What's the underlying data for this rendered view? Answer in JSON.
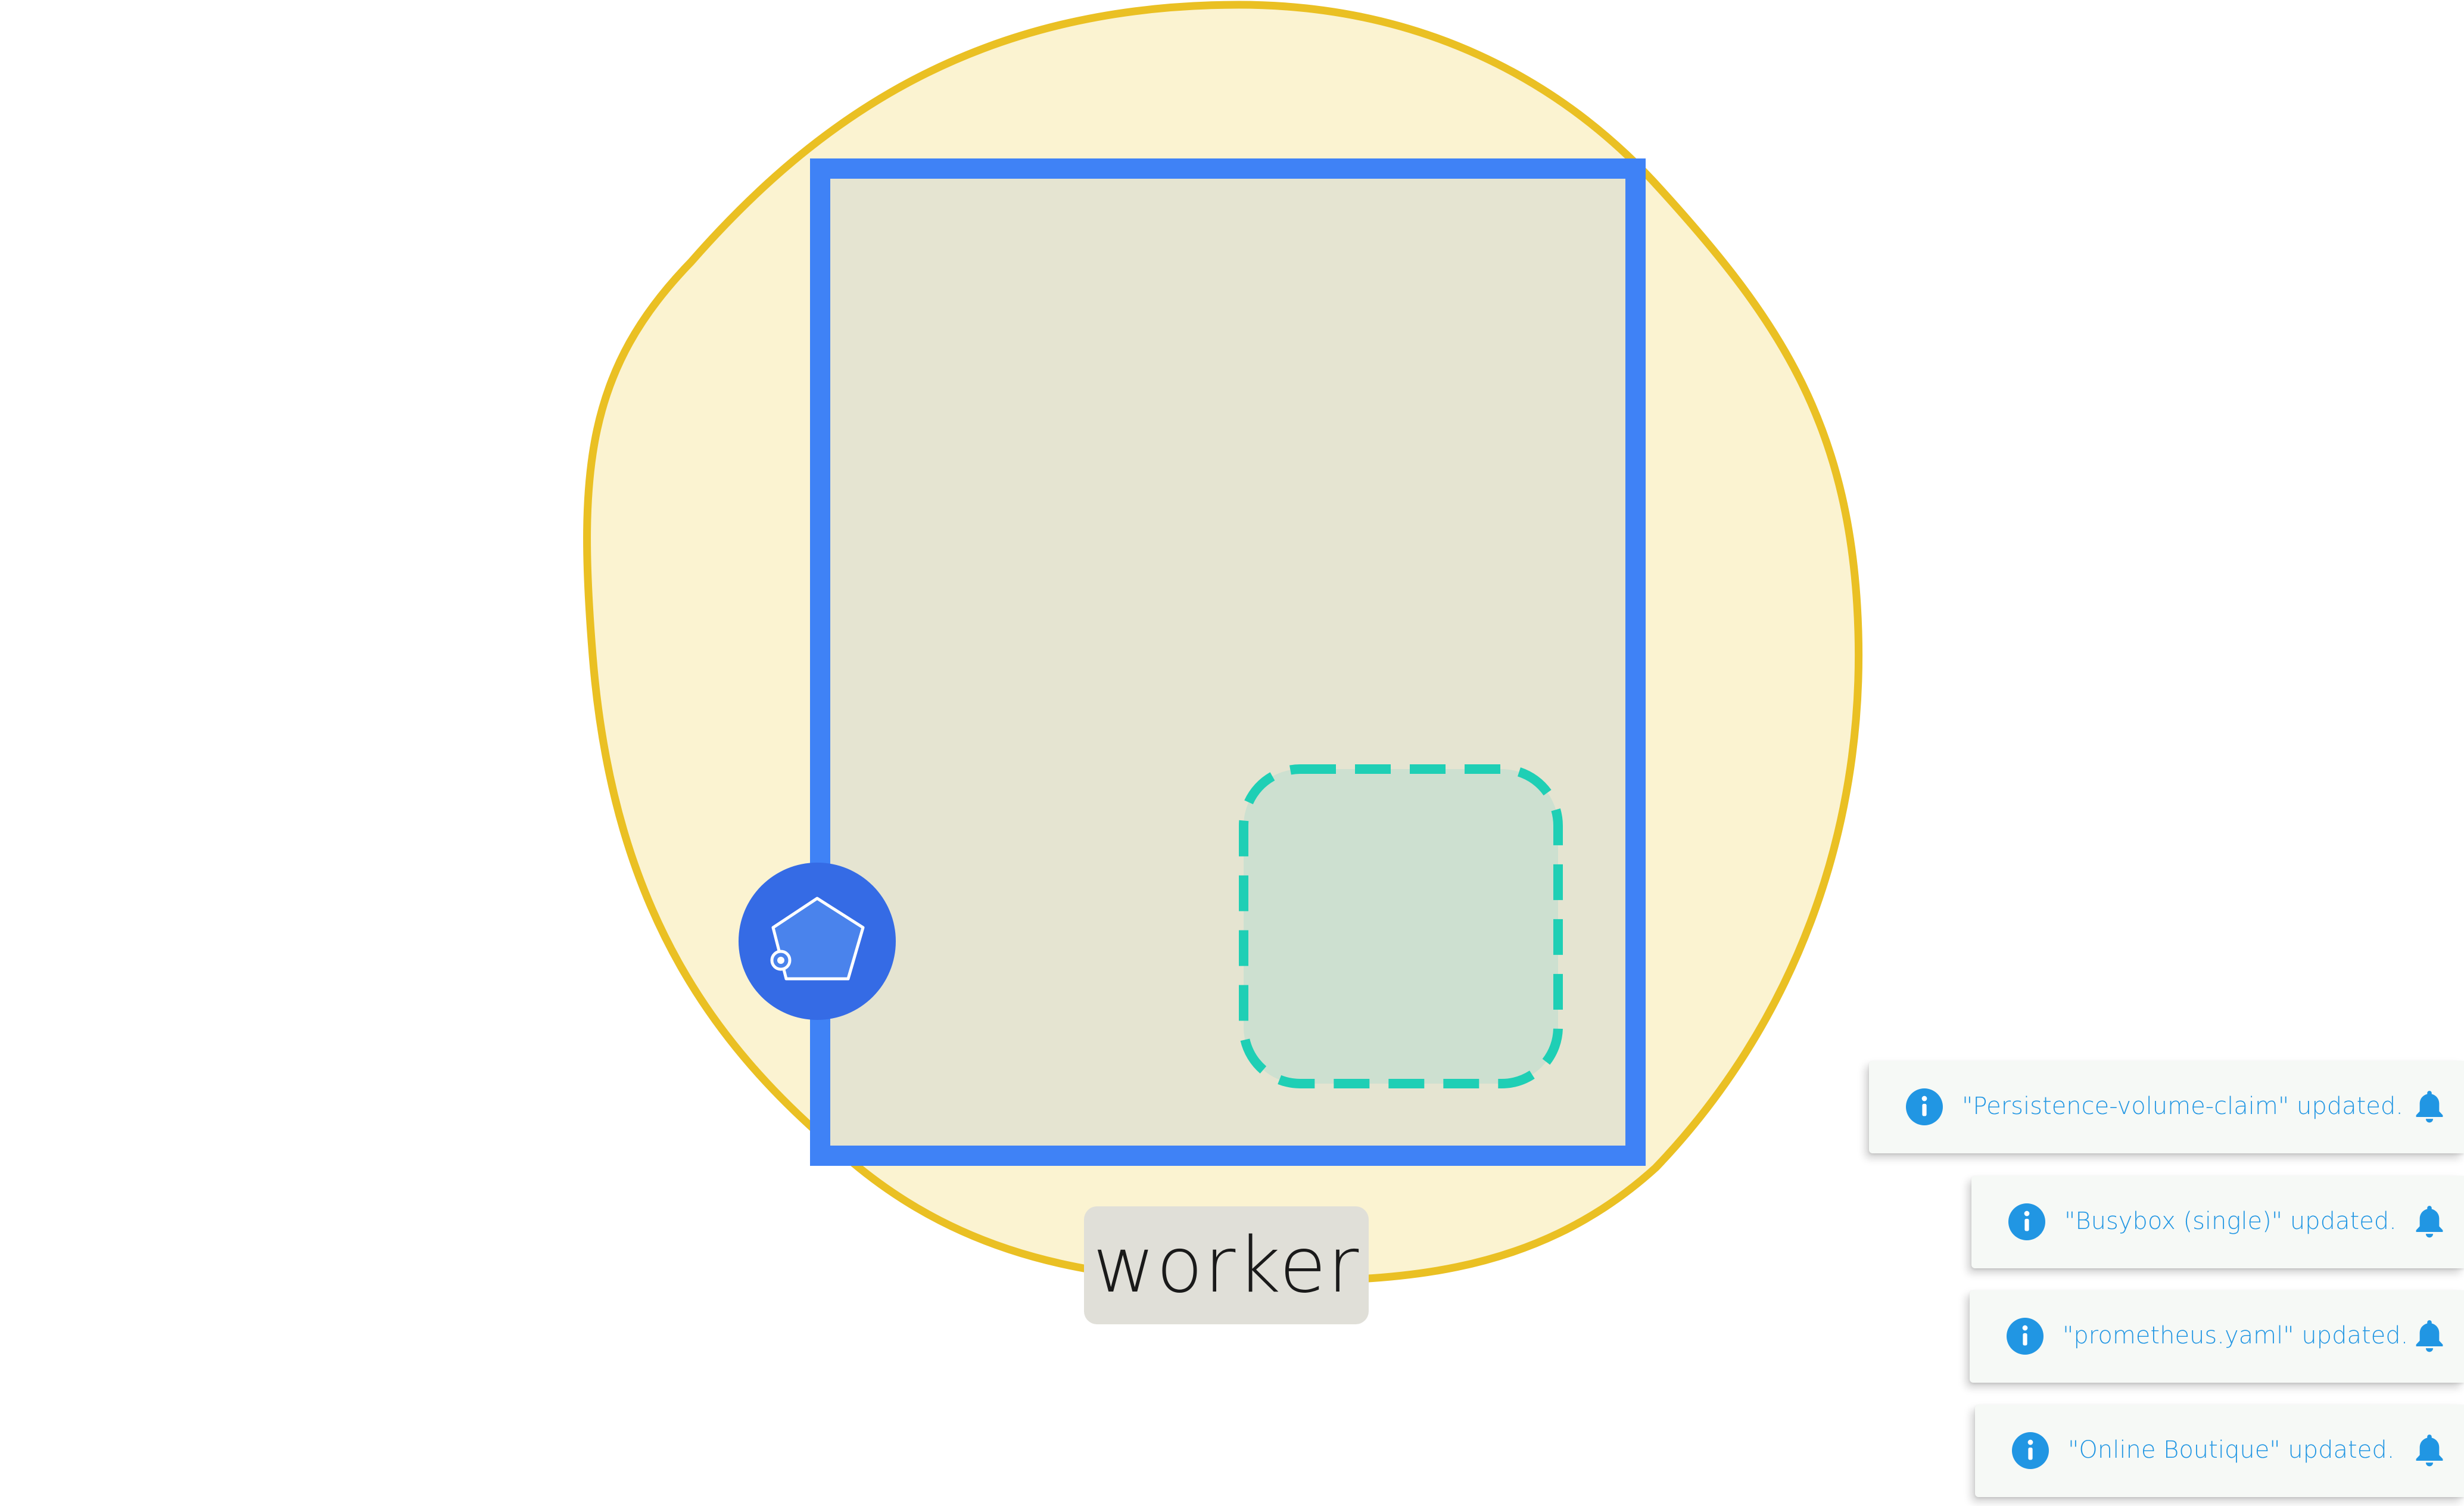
{
  "diagram": {
    "node_label": "worker",
    "colors": {
      "blob_fill": "#fbf3d1",
      "blob_stroke": "#eac023",
      "node_fill": "#e5e4d1",
      "node_stroke": "#3f82f6",
      "pod_fill": "#cde0d0",
      "pod_stroke": "#1fcfb5",
      "badge_fill": "#356be5"
    },
    "badge_icon": "pentagon-volume-icon"
  },
  "notifications": [
    {
      "text": "\"Persistence-volume-claim\" updated.",
      "icon": "info-icon",
      "action_icon": "bell-icon"
    },
    {
      "text": "\"Busybox (single)\" updated.",
      "icon": "info-icon",
      "action_icon": "bell-icon"
    },
    {
      "text": "\"prometheus.yaml\" updated.",
      "icon": "info-icon",
      "action_icon": "bell-icon"
    },
    {
      "text": "\"Online Boutique\" updated.",
      "icon": "info-icon",
      "action_icon": "bell-icon"
    }
  ],
  "accent_color": "#2196e3"
}
